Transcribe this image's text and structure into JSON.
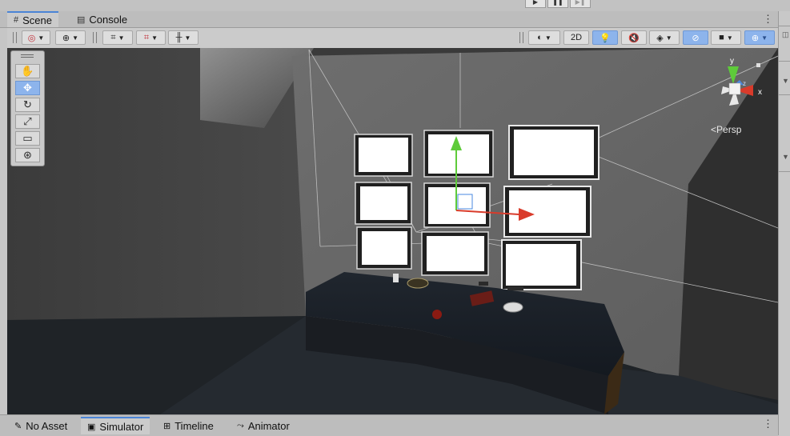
{
  "tabs": {
    "scene": "Scene",
    "console": "Console"
  },
  "scene_toolbar": {
    "toggle_2d": "2D",
    "menu_icon": "kebab-menu-icon"
  },
  "tool_panel": {
    "tools": [
      "hand-icon",
      "move-icon",
      "rotate-icon",
      "scale-icon",
      "rect-icon",
      "transform-icon"
    ],
    "active_tool": "move"
  },
  "gizmo": {
    "y_label": "y",
    "x_label": "x",
    "z_label": "z",
    "projection_label": "Persp"
  },
  "bottom_tabs": {
    "no_asset": "No Asset",
    "simulator": "Simulator",
    "timeline": "Timeline",
    "animator": "Animator"
  },
  "colors": {
    "accent": "#4a84d6",
    "active_button": "#8db4ec",
    "move_y_axis": "#5ecb3a",
    "move_x_axis": "#d93b2b"
  }
}
